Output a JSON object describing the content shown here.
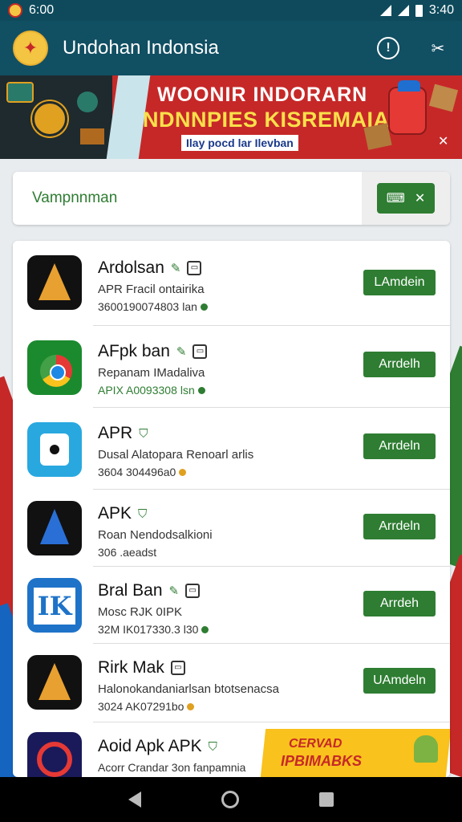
{
  "status_bar": {
    "time": "6:00",
    "right_time": "3:40"
  },
  "app_bar": {
    "title": "Undohan Indonsia",
    "icons": [
      "info-icon",
      "crossed-tools-icon"
    ]
  },
  "banner": {
    "title_line1": "WOONIR INDORARN",
    "title_line2": "NDNNPIES KISREMAIA!",
    "subtitle": "Ilay pocd lar Ilevban",
    "close": "✕"
  },
  "search": {
    "placeholder": "Vampnnman"
  },
  "apps": [
    {
      "name": "Ardolsan",
      "desc": "APR Fracil ontairika",
      "meta": "3600190074803",
      "meta_suffix": "lan",
      "button": "LAmdein"
    },
    {
      "name": "AFpk ban",
      "desc": "Repanam IMadaliva",
      "meta": "APIX A0093308",
      "meta_suffix": "lsn",
      "button": "Arrdelh"
    },
    {
      "name": "APR",
      "desc": "Dusal Alatopara Renoarl arlis",
      "meta": "3604 304496a0",
      "meta_suffix": "",
      "button": "Arrdeln"
    },
    {
      "name": "APK",
      "desc": "Roan Nendodsalkioni",
      "meta": "306 .aeadst",
      "meta_suffix": "",
      "button": "Arrdeln"
    },
    {
      "name": "Bral Ban",
      "desc": "Mosc RJK 0IPK",
      "meta": "32M IK017330.3",
      "meta_suffix": "l30",
      "button": "Arrdeh"
    },
    {
      "name": "Rirk Mak",
      "desc": "Halonokandaniarlsan btotsenacsa",
      "meta": "3024 AK07291bo",
      "meta_suffix": "",
      "button": "UAmdeln"
    },
    {
      "name": "Aoid Apk APK",
      "desc": "Acorr Crandar 3on fanpamnia",
      "meta": "",
      "meta_suffix": "",
      "button": ""
    }
  ],
  "ad": {
    "line1": "CERVAD",
    "line2": "IPBIMABKS"
  }
}
